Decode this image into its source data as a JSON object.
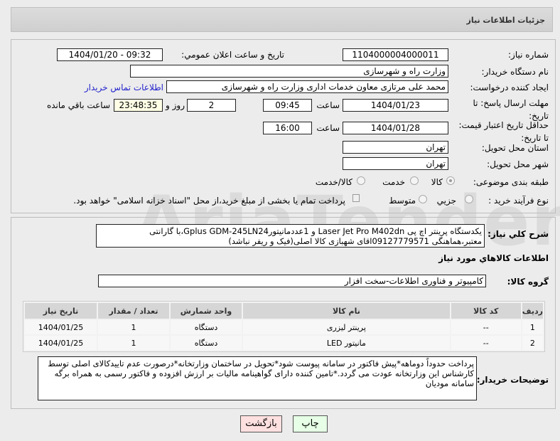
{
  "header": {
    "title": "جزئیات اطلاعات نیاز"
  },
  "form": {
    "need_number_label": "شماره نیاز:",
    "need_number": "1104000004000011",
    "announce_label": "تاریخ و ساعت اعلان عمومي:",
    "announce_value": "1404/01/20 - 09:32",
    "buyer_org_label": "نام دستگاه خریدار:",
    "buyer_org": "وزارت راه و شهرسازی",
    "creator_label": "ایجاد کننده درخواست:",
    "creator": "محمد علی  مرتازی معاون خدمات اداری وزارت راه و شهرسازی",
    "contact_link": "اطلاعات تماس خریدار",
    "deadline_label": "مهلت ارسال پاسخ: تا تاریخ:",
    "deadline_date": "1404/01/23",
    "time_label": "ساعت",
    "deadline_time": "09:45",
    "days": "2",
    "days_label": "روز و",
    "remaining": "23:48:35",
    "remaining_label": "ساعت باقي مانده",
    "validity_label": "حداقل تاریخ اعتبار قیمت: تا تاریخ:",
    "validity_date": "1404/01/28",
    "validity_time": "16:00",
    "province_label": "استان محل تحویل:",
    "province": "تهران",
    "city_label": "شهر محل تحویل:",
    "city": "تهران",
    "category_label": "طبقه بندی موضوعی:",
    "category_options": [
      "کالا",
      "خدمت",
      "کالا/خدمت"
    ],
    "process_label": "نوع فرآیند خرید :",
    "process_options": [
      "جزیي",
      "متوسط"
    ],
    "treasury_text": "پرداخت تمام یا بخشی از مبلغ خرید،از محل \"اسناد خزانه اسلامی\" خواهد بود."
  },
  "details": {
    "description_label": "شرح کلي نیاز:",
    "description": "یکدستگاه پرینتر اچ پی Laser Jet Pro M402dn و 1عددمانیتورGplus GDM-245LN24،با گارانتی معتبر،هماهنگی 09127779571اقای شهبازی کالا اصلی(فیک و ریفر نباشد)",
    "goods_heading": "اطلاعات کالاهاي مورد نیاز",
    "group_label": "گروه کالا:",
    "group": "کامپیوتر و فناوری اطلاعات-سخت افزار",
    "table": {
      "headers": [
        "ردیف",
        "کد کالا",
        "نام کالا",
        "واحد شمارش",
        "تعداد / مقدار",
        "تاریخ نیاز"
      ],
      "rows": [
        [
          "1",
          "--",
          "پرینتر لیزری",
          "دستگاه",
          "1",
          "1404/01/25"
        ],
        [
          "2",
          "--",
          "مانیتور LED",
          "دستگاه",
          "1",
          "1404/01/25"
        ]
      ]
    },
    "notes_label": "توضیحات خریدار:",
    "notes": "پرداخت حدوداً دوماهه*پیش فاکتور در سامانه پیوست شود*تحویل در ساختمان وزارتخانه*درصورت عدم تاییدکالای اصلی توسط کارشناس این وزارتخانه عودت می گردد.*تامین کننده دارای گواهینامه مالیات بر ارزش افزوده و فاکتور رسمی به همراه برگه  سامانه مودیان"
  },
  "buttons": {
    "print": "چاپ",
    "back": "بازگشت"
  },
  "watermark": "AriaTender.net"
}
